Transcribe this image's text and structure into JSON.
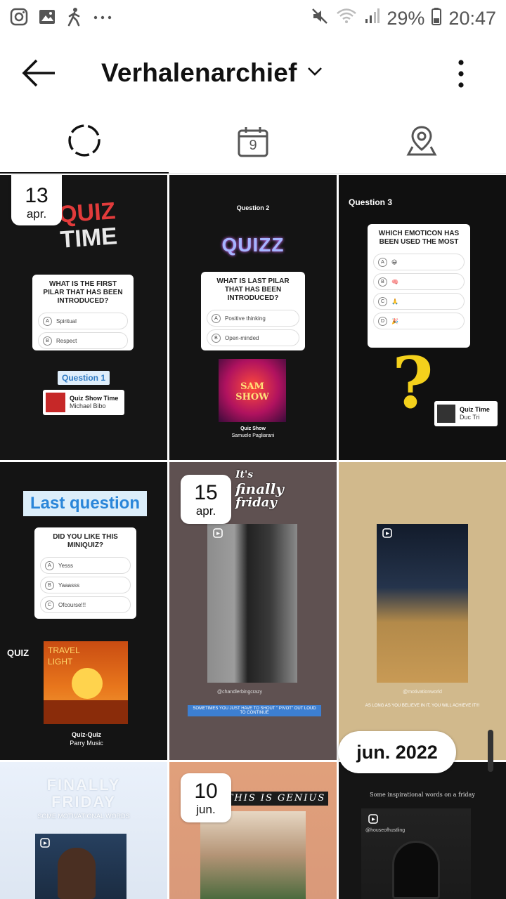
{
  "status_bar": {
    "icons_left": [
      "instagram-icon",
      "gallery-icon",
      "walking-icon",
      "more-notifications-icon"
    ],
    "battery": "29%",
    "time": "20:47"
  },
  "app_bar": {
    "title": "Verhalenarchief"
  },
  "tabs": [
    {
      "name": "stories-archive",
      "icon": "circle-dashed-icon",
      "selected": true
    },
    {
      "name": "calendar",
      "icon": "calendar-icon",
      "calendar_day": "9"
    },
    {
      "name": "map",
      "icon": "map-pin-icon"
    }
  ],
  "grid": {
    "month_label": "jun. 2022",
    "cells": [
      {
        "date_day": "13",
        "date_month": "apr.",
        "quiz_title_1": "QUIZ",
        "quiz_title_2": "TIME",
        "question": "WHAT IS THE FIRST PILAR THAT HAS BEEN INTRODUCED?",
        "options": [
          {
            "letter": "A",
            "text": "Spiritual"
          },
          {
            "letter": "B",
            "text": "Respect"
          }
        ],
        "badge": "Question 1",
        "music_title": "Quiz Show Time",
        "music_artist": "Michael Bibo"
      },
      {
        "heading": "Question 2",
        "quiz_title": "QUIZZ",
        "question": "WHAT IS LAST PILAR THAT HAS BEEN INTRODUCED?",
        "options": [
          {
            "letter": "A",
            "text": "Positive thinking"
          },
          {
            "letter": "B",
            "text": "Open-minded"
          }
        ],
        "album_text": "SAM SHOW",
        "music_title": "Quiz Show",
        "music_artist": "Samuele Pagliarani"
      },
      {
        "heading": "Question 3",
        "question": "WHICH EMOTICON HAS BEEN USED THE MOST",
        "options": [
          {
            "letter": "A",
            "text": "😀"
          },
          {
            "letter": "B",
            "text": "🧠"
          },
          {
            "letter": "C",
            "text": "🙏"
          },
          {
            "letter": "D",
            "text": "🎉"
          }
        ],
        "music_title": "Quiz Time",
        "music_artist": "Duc Tri"
      },
      {
        "heading": "Last question",
        "question": "DID YOU LIKE THIS MINIQUIZ?",
        "options": [
          {
            "letter": "A",
            "text": "Yesss"
          },
          {
            "letter": "B",
            "text": "Yaaasss"
          },
          {
            "letter": "C",
            "text": "Ofcourse!!!"
          }
        ],
        "side_label": "QUIZ",
        "album_text_1": "TRAVEL",
        "album_text_2": "LIGHT",
        "music_title": "Quiz-Quiz",
        "music_artist": "Parry Music"
      },
      {
        "date_day": "15",
        "date_month": "apr.",
        "sticker_1": "It's",
        "sticker_2": "finally",
        "sticker_3": "friday",
        "handle": "@chandlerbingcrazy",
        "caption": "SOMETIMES YOU JUST HAVE TO SHOUT \" PIVOT\" OUT LOUD TO CONTINUE"
      },
      {
        "handle": "@motivationworld",
        "caption": "AS LONG AS YOU BELIEVE IN IT, YOU WILL ACHIEVE IT!!!"
      },
      {
        "headline_1": "FINALLY",
        "headline_2": "FRIDAY",
        "subline": "SOME MOTIVATIONAL WORDS"
      },
      {
        "date_day": "10",
        "date_month": "jun.",
        "banner": "THIS IS GENIUS"
      },
      {
        "caption": "Some inspirational words on a friday",
        "handle": "@houseofhustling"
      }
    ]
  },
  "colors": {
    "accent_blue": "#4fa8e6",
    "quiz_orange": "#e8541e",
    "dark_story": "#141414"
  }
}
